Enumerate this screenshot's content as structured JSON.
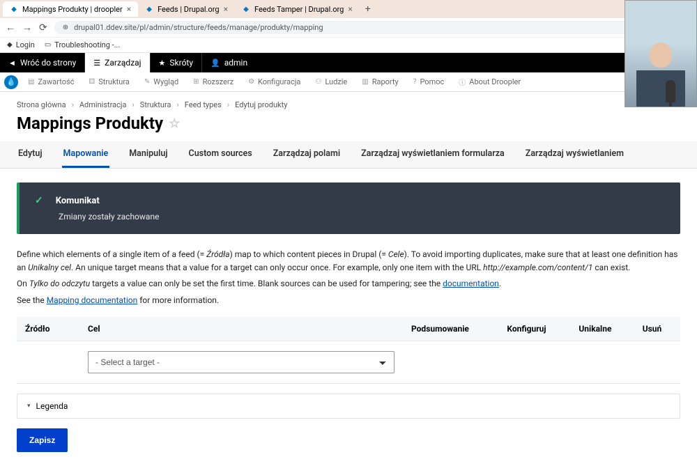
{
  "browser": {
    "tabs": [
      {
        "label": "Mappings Produkty | droopler",
        "active": true
      },
      {
        "label": "Feeds | Drupal.org",
        "active": false
      },
      {
        "label": "Feeds Tamper | Drupal.org",
        "active": false
      }
    ],
    "url": "drupal01.ddev.site/pl/admin/structure/feeds/manage/produkty/mapping",
    "bookmarks": [
      {
        "label": "Login"
      },
      {
        "label": "Troubleshooting -..."
      }
    ]
  },
  "admin_toolbar": {
    "back": "Wróć do strony",
    "manage": "Zarządzaj",
    "shortcuts": "Skróty",
    "user": "admin"
  },
  "secondary_toolbar": [
    {
      "label": "Zawartość"
    },
    {
      "label": "Struktura"
    },
    {
      "label": "Wygląd"
    },
    {
      "label": "Rozszerz"
    },
    {
      "label": "Konfiguracja"
    },
    {
      "label": "Ludzie"
    },
    {
      "label": "Raporty"
    },
    {
      "label": "Pomoc"
    },
    {
      "label": "About Droopler"
    }
  ],
  "breadcrumb": [
    "Strona główna",
    "Administracja",
    "Struktura",
    "Feed types",
    "Edytuj produkty"
  ],
  "page_title": "Mappings Produkty",
  "tabs": [
    "Edytuj",
    "Mapowanie",
    "Manipuluj",
    "Custom sources",
    "Zarządzaj polami",
    "Zarządzaj wyświetlaniem formularza",
    "Zarządzaj wyświetlaniem"
  ],
  "active_tab": 1,
  "message": {
    "heading": "Komunikat",
    "body": "Zmiany zostały zachowane"
  },
  "description": {
    "p1a": "Define which elements of a single item of a feed (= ",
    "p1b": "Źródła",
    "p1c": ") map to which content pieces in Drupal (= ",
    "p1d": "Cele",
    "p1e": "). To avoid importing duplicates, make sure that at least one definition has an ",
    "p1f": "Unikalny cel",
    "p1g": ". An unique target means that a value for a target can only occur once. For example, only one item with the URL ",
    "p1h": "http://example.com/content/1",
    "p1i": " can exist.",
    "p2a": "On ",
    "p2b": "Tylko do odczytu",
    "p2c": " targets a value can only be set the first time. Blank sources can be used for tampering; see the ",
    "p2d": "documentation",
    "p2e": ".",
    "p3a": "See the ",
    "p3b": "Mapping documentation",
    "p3c": " for more information."
  },
  "table": {
    "headers": [
      "Źródło",
      "Cel",
      "Podsumowanie",
      "Konfiguruj",
      "Unikalne",
      "Usuń"
    ],
    "select_placeholder": "- Select a target -"
  },
  "legend_label": "Legenda",
  "save_label": "Zapisz"
}
